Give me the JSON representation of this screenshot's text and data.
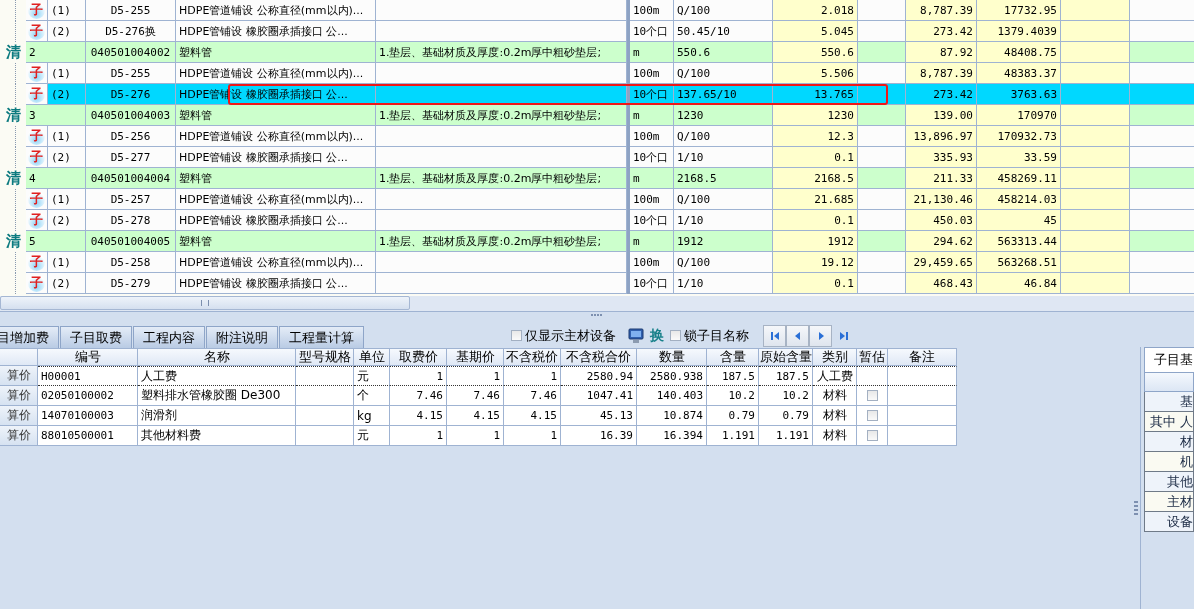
{
  "bill_grid": {
    "highlight_frame": true,
    "rows": [
      {
        "kind": "sub",
        "marker": "子",
        "number": "(1)",
        "code": "D5-255",
        "name": "HDPE管道铺设 公称直径(mm以内)...",
        "feature": "",
        "unit": "100m",
        "expression": "Q/100",
        "quantity": "2.018",
        "unit_price": "8,787.39",
        "total": "17732.95",
        "selected": false
      },
      {
        "kind": "sub",
        "marker": "子",
        "number": "(2)",
        "code": "D5-276换",
        "name": "HDPE管铺设 橡胶圈承插接口 公...",
        "feature": "",
        "unit": "10个口",
        "expression": "50.45/10",
        "quantity": "5.045",
        "unit_price": "273.42",
        "total": "1379.4039",
        "selected": false
      },
      {
        "kind": "bill",
        "marker": "清",
        "number": "2",
        "code": "040501004002",
        "name": "塑料管",
        "feature": "1.垫层、基础材质及厚度:0.2m厚中粗砂垫层;",
        "unit": "m",
        "expression": "550.6",
        "quantity": "550.6",
        "unit_price": "87.92",
        "total": "48408.75",
        "selected": false
      },
      {
        "kind": "sub",
        "marker": "子",
        "number": "(1)",
        "code": "D5-255",
        "name": "HDPE管道铺设 公称直径(mm以内)...",
        "feature": "",
        "unit": "100m",
        "expression": "Q/100",
        "quantity": "5.506",
        "unit_price": "8,787.39",
        "total": "48383.37",
        "selected": false
      },
      {
        "kind": "sub",
        "marker": "子",
        "number": "(2)",
        "code": "D5-276",
        "name": "HDPE管铺设 橡胶圈承插接口 公...",
        "feature": "",
        "unit": "10个口",
        "expression": "137.65/10",
        "quantity": "13.765",
        "unit_price": "273.42",
        "total": "3763.63",
        "selected": true
      },
      {
        "kind": "bill",
        "marker": "清",
        "number": "3",
        "code": "040501004003",
        "name": "塑料管",
        "feature": "1.垫层、基础材质及厚度:0.2m厚中粗砂垫层;",
        "unit": "m",
        "expression": "1230",
        "quantity": "1230",
        "unit_price": "139.00",
        "total": "170970",
        "selected": false
      },
      {
        "kind": "sub",
        "marker": "子",
        "number": "(1)",
        "code": "D5-256",
        "name": "HDPE管道铺设 公称直径(mm以内)...",
        "feature": "",
        "unit": "100m",
        "expression": "Q/100",
        "quantity": "12.3",
        "unit_price": "13,896.97",
        "total": "170932.73",
        "selected": false
      },
      {
        "kind": "sub",
        "marker": "子",
        "number": "(2)",
        "code": "D5-277",
        "name": "HDPE管铺设 橡胶圈承插接口 公...",
        "feature": "",
        "unit": "10个口",
        "expression": "1/10",
        "quantity": "0.1",
        "unit_price": "335.93",
        "total": "33.59",
        "selected": false
      },
      {
        "kind": "bill",
        "marker": "清",
        "number": "4",
        "code": "040501004004",
        "name": "塑料管",
        "feature": "1.垫层、基础材质及厚度:0.2m厚中粗砂垫层;",
        "unit": "m",
        "expression": "2168.5",
        "quantity": "2168.5",
        "unit_price": "211.33",
        "total": "458269.11",
        "selected": false
      },
      {
        "kind": "sub",
        "marker": "子",
        "number": "(1)",
        "code": "D5-257",
        "name": "HDPE管道铺设 公称直径(mm以内)...",
        "feature": "",
        "unit": "100m",
        "expression": "Q/100",
        "quantity": "21.685",
        "unit_price": "21,130.46",
        "total": "458214.03",
        "selected": false
      },
      {
        "kind": "sub",
        "marker": "子",
        "number": "(2)",
        "code": "D5-278",
        "name": "HDPE管铺设 橡胶圈承插接口 公...",
        "feature": "",
        "unit": "10个口",
        "expression": "1/10",
        "quantity": "0.1",
        "unit_price": "450.03",
        "total": "45",
        "selected": false
      },
      {
        "kind": "bill",
        "marker": "清",
        "number": "5",
        "code": "040501004005",
        "name": "塑料管",
        "feature": "1.垫层、基础材质及厚度:0.2m厚中粗砂垫层;",
        "unit": "m",
        "expression": "1912",
        "quantity": "1912",
        "unit_price": "294.62",
        "total": "563313.44",
        "selected": false
      },
      {
        "kind": "sub",
        "marker": "子",
        "number": "(1)",
        "code": "D5-258",
        "name": "HDPE管道铺设 公称直径(mm以内)...",
        "feature": "",
        "unit": "100m",
        "expression": "Q/100",
        "quantity": "19.12",
        "unit_price": "29,459.65",
        "total": "563268.51",
        "selected": false
      },
      {
        "kind": "sub",
        "marker": "子",
        "number": "(2)",
        "code": "D5-279",
        "name": "HDPE管铺设 橡胶圈承插接口 公...",
        "feature": "",
        "unit": "10个口",
        "expression": "1/10",
        "quantity": "0.1",
        "unit_price": "468.43",
        "total": "46.84",
        "selected": false
      }
    ]
  },
  "tabs": [
    {
      "label": "目增加费",
      "selected": false
    },
    {
      "label": "子目取费",
      "selected": false
    },
    {
      "label": "工程内容",
      "selected": false
    },
    {
      "label": "附注说明",
      "selected": false
    },
    {
      "label": "工程量计算",
      "selected": false
    }
  ],
  "toolbar": {
    "main_material_only": {
      "label": "仅显示主材设备",
      "checked": false
    },
    "replace_glyph": "换",
    "lock_name": {
      "label": "锁子目名称",
      "checked": false
    }
  },
  "resource_table": {
    "columns": [
      "编号",
      "名称",
      "型号规格",
      "单位",
      "取费价",
      "基期价",
      "不含税价",
      "不含税合价",
      "数量",
      "含量",
      "原始含量",
      "类别",
      "暂估",
      "备注"
    ],
    "rows": [
      {
        "row_header": "算价",
        "code": "H00001",
        "name": "人工费",
        "spec": "",
        "unit": "元",
        "fee_price": "1",
        "base_price": "1",
        "pretax_price": "1",
        "pretax_total": "2580.94",
        "amount": "2580.938",
        "content": "187.5",
        "original_content": "187.5",
        "category": "人工费",
        "focused": true
      },
      {
        "row_header": "算价",
        "code": "02050100002",
        "name": "塑料排水管橡胶圈 De300",
        "spec": "",
        "unit": "个",
        "fee_price": "7.46",
        "base_price": "7.46",
        "pretax_price": "7.46",
        "pretax_total": "1047.41",
        "amount": "140.403",
        "content": "10.2",
        "original_content": "10.2",
        "category": "材料",
        "provisional": false,
        "focused": false
      },
      {
        "row_header": "算价",
        "code": "14070100003",
        "name": "润滑剂",
        "spec": "",
        "unit": "kg",
        "fee_price": "4.15",
        "base_price": "4.15",
        "pretax_price": "4.15",
        "pretax_total": "45.13",
        "amount": "10.874",
        "content": "0.79",
        "original_content": "0.79",
        "category": "材料",
        "provisional": false,
        "focused": false
      },
      {
        "row_header": "算价",
        "code": "88010500001",
        "name": "其他材料费",
        "spec": "",
        "unit": "元",
        "fee_price": "1",
        "base_price": "1",
        "pretax_price": "1",
        "pretax_total": "16.39",
        "amount": "16.394",
        "content": "1.191",
        "original_content": "1.191",
        "category": "材料",
        "provisional": false,
        "focused": false
      }
    ]
  },
  "price_panel": {
    "tab": {
      "label": "子目基",
      "selected": true
    },
    "rows": [
      "基",
      "其中 人",
      "材",
      "机",
      "其他",
      "主材",
      "设备"
    ]
  }
}
